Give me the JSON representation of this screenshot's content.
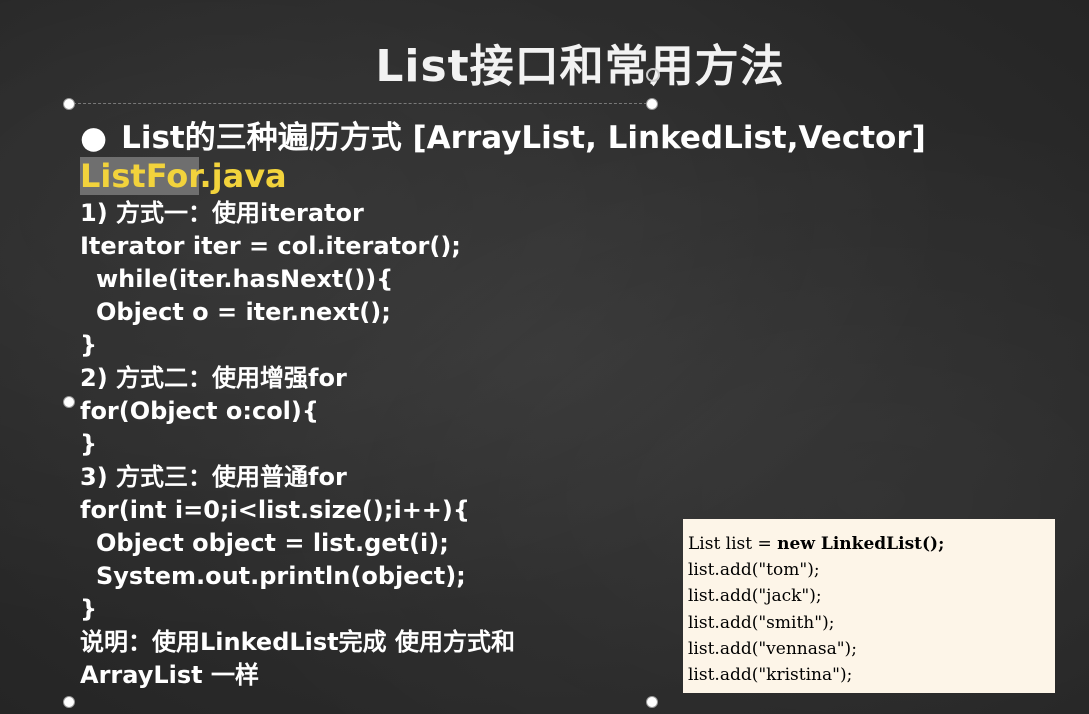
{
  "slide": {
    "title": "List接口和常用方法",
    "bullet": "List的三种遍历方式 [ArrayList, LinkedList,Vector]",
    "filename_main": "ListFor",
    "filename_ext": ".java",
    "lines": [
      "1) 方式一：使用iterator",
      "Iterator iter = col.iterator();",
      "while(iter.hasNext()){",
      "Object o = iter.next();",
      "}",
      "2) 方式二：使用增强for",
      "for(Object o:col){",
      "}",
      "3) 方式三：使用普通for",
      "for(int i=0;i<list.size();i++){",
      "Object object = list.get(i);",
      "System.out.println(object);",
      "}",
      "说明：使用LinkedList完成 使用方式和",
      "ArrayList 一样"
    ]
  },
  "code_box": {
    "line1_a": "List list = ",
    "line1_kw": "new LinkedList();",
    "lines": [
      "list.add(\"tom\");",
      "list.add(\"jack\");",
      "list.add(\"smith\");",
      "list.add(\"vennasa\");",
      "list.add(\"kristina\");"
    ]
  }
}
